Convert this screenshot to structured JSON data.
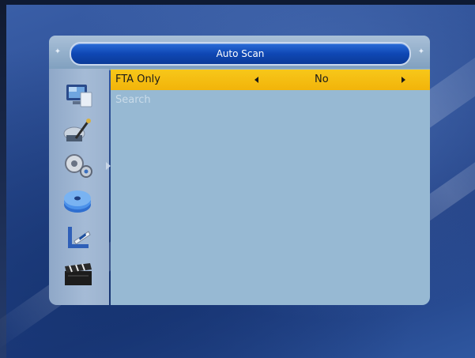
{
  "window": {
    "title": "Auto Scan"
  },
  "sidebar": {
    "icons": [
      {
        "name": "monitor-icon"
      },
      {
        "name": "antenna-tools-icon"
      },
      {
        "name": "gears-icon"
      },
      {
        "name": "media-disc-icon"
      },
      {
        "name": "chart-pen-icon"
      },
      {
        "name": "clapperboard-icon"
      }
    ]
  },
  "menu": {
    "items": [
      {
        "label": "FTA Only",
        "value": "No",
        "selected": true
      },
      {
        "label": "Search",
        "selected": false
      }
    ]
  },
  "colors": {
    "highlight": "#f2b40a",
    "title_pill": "#0f47b4",
    "content_bg": "#97b9d3"
  }
}
